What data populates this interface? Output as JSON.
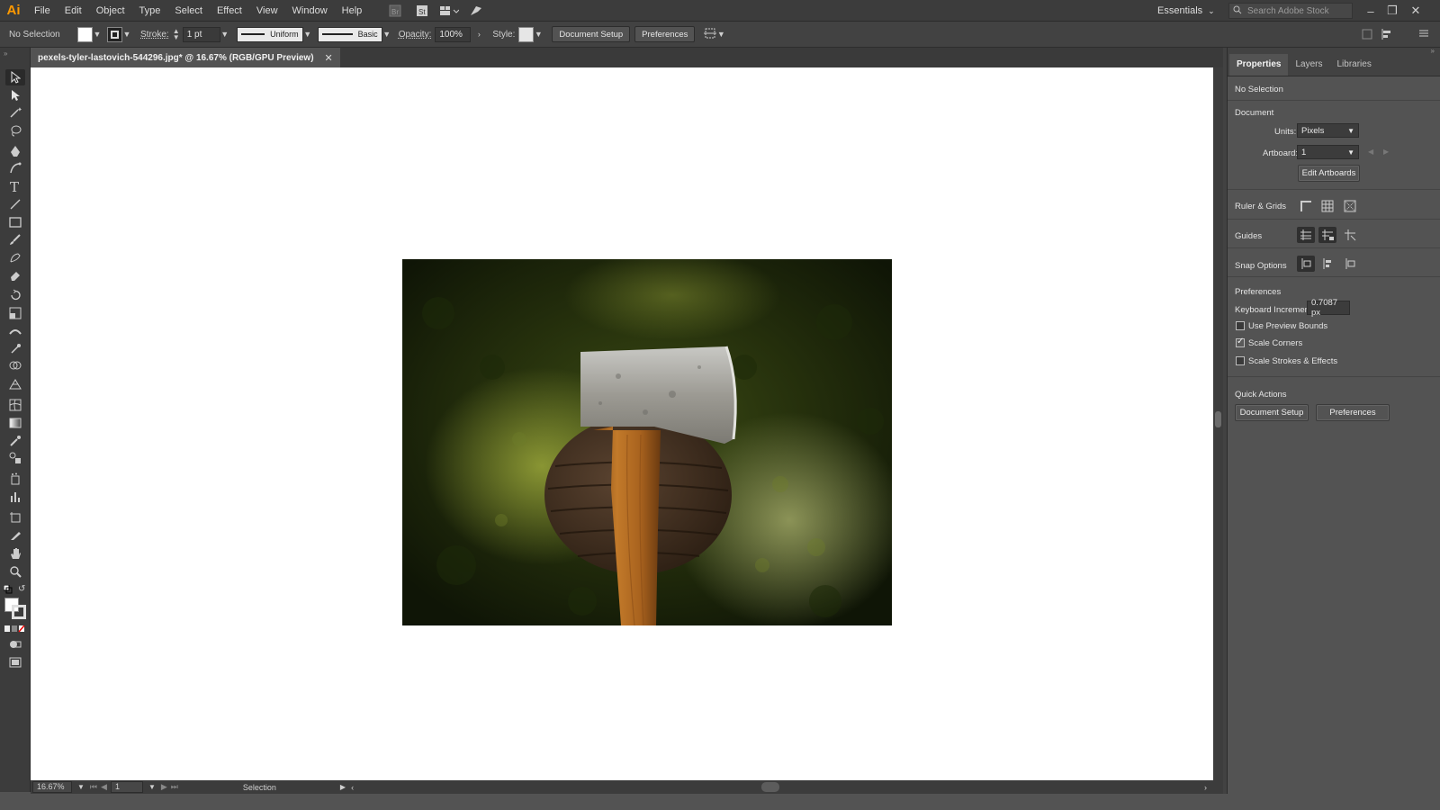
{
  "app": {
    "logo": "Ai",
    "document_title": "pexels-tyler-lastovich-544296.jpg* @ 16.67% (RGB/GPU Preview)"
  },
  "menu": [
    "File",
    "Edit",
    "Object",
    "Type",
    "Select",
    "Effect",
    "View",
    "Window",
    "Help"
  ],
  "menubar": {
    "workspace": "Essentials",
    "search_placeholder": "Search Adobe Stock"
  },
  "control_bar": {
    "selection_label": "No Selection",
    "stroke_label": "Stroke:",
    "stroke_weight": "1 pt",
    "variable_width": "Uniform",
    "brush_definition": "Basic",
    "opacity_label": "Opacity:",
    "opacity_value": "100%",
    "style_label": "Style:",
    "document_setup_button": "Document Setup",
    "preferences_button": "Preferences"
  },
  "status_bar": {
    "zoom": "16.67%",
    "artboard": "1",
    "tool": "Selection"
  },
  "properties_panel": {
    "tabs": [
      "Properties",
      "Layers",
      "Libraries"
    ],
    "active_tab": "Properties",
    "selection_state": "No Selection",
    "document_heading": "Document",
    "units_label": "Units:",
    "units_value": "Pixels",
    "artboard_label": "Artboard:",
    "artboard_value": "1",
    "edit_artboards_button": "Edit Artboards",
    "ruler_grids_label": "Ruler & Grids",
    "guides_label": "Guides",
    "snap_options_label": "Snap Options",
    "preferences_heading": "Preferences",
    "keyboard_increment_label": "Keyboard Increment:",
    "keyboard_increment_value": "0.7087 px",
    "checkboxes": [
      {
        "label": "Use Preview Bounds",
        "checked": false
      },
      {
        "label": "Scale Corners",
        "checked": true
      },
      {
        "label": "Scale Strokes & Effects",
        "checked": false
      }
    ],
    "quick_actions_heading": "Quick Actions",
    "quick_actions": [
      "Document Setup",
      "Preferences"
    ]
  },
  "colors": {
    "accent_logo": "#ff9a00",
    "panel_bg": "#535353",
    "chrome_bg": "#3c3c3c",
    "canvas": "#ffffff"
  }
}
